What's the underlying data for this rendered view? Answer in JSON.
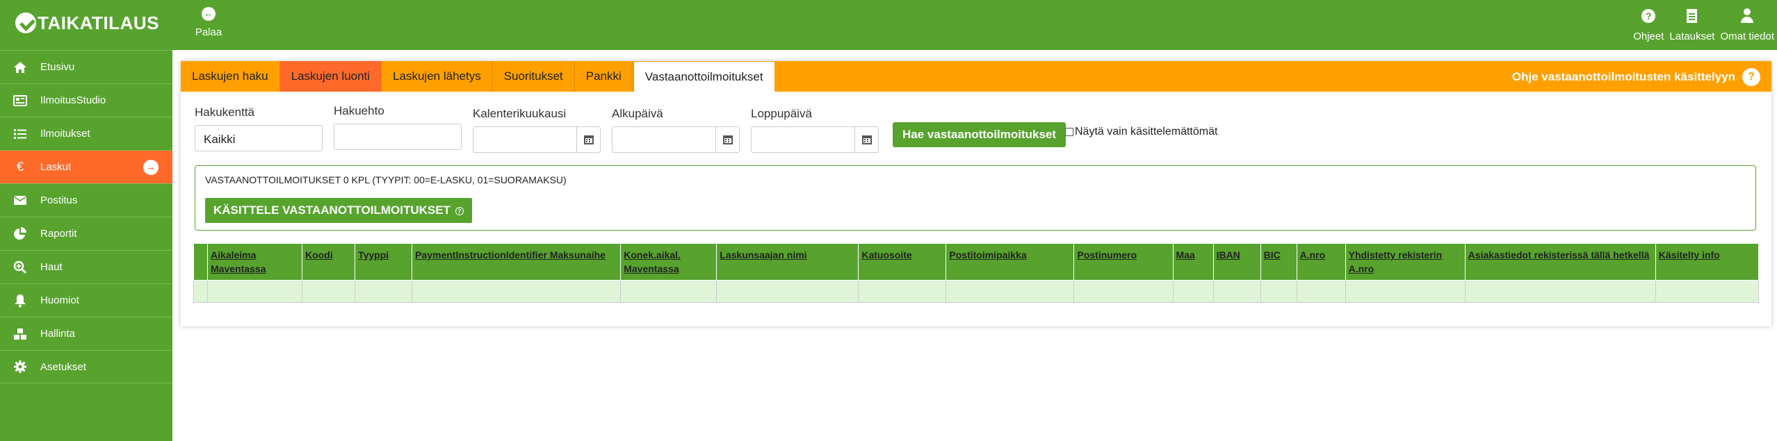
{
  "header": {
    "logo_text": "TAIKATILAUS",
    "back_label": "Palaa",
    "nav": [
      {
        "label": "Ohjeet",
        "icon": "help-icon"
      },
      {
        "label": "Lataukset",
        "icon": "document-icon"
      },
      {
        "label": "Omat tiedot",
        "icon": "user-icon"
      }
    ]
  },
  "sidebar": {
    "items": [
      {
        "label": "Etusivu",
        "icon": "home-icon"
      },
      {
        "label": "IlmoitusStudio",
        "icon": "newspaper-icon"
      },
      {
        "label": "Ilmoitukset",
        "icon": "list-icon"
      },
      {
        "label": "Laskut",
        "icon": "euro-icon",
        "active": true
      },
      {
        "label": "Postitus",
        "icon": "envelope-icon"
      },
      {
        "label": "Raportit",
        "icon": "pie-chart-icon"
      },
      {
        "label": "Haut",
        "icon": "search-plus-icon"
      },
      {
        "label": "Huomiot",
        "icon": "bell-icon"
      },
      {
        "label": "Hallinta",
        "icon": "cubes-icon"
      },
      {
        "label": "Asetukset",
        "icon": "gear-icon"
      }
    ]
  },
  "tabs": [
    {
      "label": "Laskujen haku"
    },
    {
      "label": "Laskujen luonti"
    },
    {
      "label": "Laskujen lähetys"
    },
    {
      "label": "Suoritukset"
    },
    {
      "label": "Pankki"
    },
    {
      "label": "Vastaanottoilmoitukset",
      "active": true
    }
  ],
  "tab_help": "Ohje vastaanottoilmoitusten käsittelyyn",
  "form": {
    "hakukentta_label": "Hakukenttä",
    "hakukentta_value": "Kaikki",
    "hakuehto_label": "Hakuehto",
    "hakuehto_value": "",
    "kalenterikuukausi_label": "Kalenterikuukausi",
    "alkupaiva_label": "Alkupäivä",
    "loppupaiva_label": "Loppupäivä",
    "search_button": "Hae vastaanottoilmoitukset",
    "checkbox_label": "Näytä vain käsittelemättömät"
  },
  "results": {
    "count_text": "VASTAANOTTOILMOITUKSET 0 KPL (TYYPIT: 00=E-LASKU, 01=SUORAMAKSU)",
    "process_button": "KÄSITTELE VASTAANOTTOILMOITUKSET",
    "process_button_hint": "?"
  },
  "table": {
    "columns": [
      "",
      "Aikaleima Maventassa",
      "Koodi",
      "Tyyppi",
      "PaymentInstructionIdentifier Maksunaihe",
      "Konek.aikal. Maventassa",
      "Laskunsaajan nimi",
      "Katuosoite",
      "Postitoimipaikka",
      "Postinumero",
      "Maa",
      "IBAN",
      "BIC",
      "A.nro",
      "Yhdistetty rekisterin A.nro",
      "Asiakastiedot rekisterissä tällä hetkellä",
      "Käsitelty info"
    ],
    "rows": [
      [
        "",
        "",
        "",
        "",
        "",
        "",
        "",
        "",
        "",
        "",
        "",
        "",
        "",
        "",
        "",
        "",
        ""
      ]
    ]
  },
  "colors": {
    "green": "#57a32e",
    "orange": "#ffa000",
    "active_orange": "#ff6a2b",
    "row_bg": "#e0f5d8"
  }
}
